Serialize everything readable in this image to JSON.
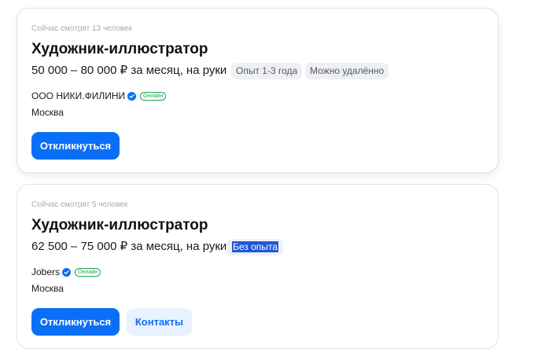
{
  "vacancies": [
    {
      "viewers": "Сейчас смотрят 13 человек",
      "title": "Художник-иллюстратор",
      "salary": "50 000 – 80 000 ₽ за месяц, на руки",
      "tags": [
        "Опыт 1-3 года",
        "Можно удалённо"
      ],
      "company": "ООО НИКИ.ФИЛИНИ",
      "online": "Онлайн",
      "city": "Москва",
      "respond_label": "Откликнуться"
    },
    {
      "viewers": "Сейчас смотрят 5 человек",
      "title": "Художник-иллюстратор",
      "salary": "62 500 – 75 000 ₽ за месяц, на руки",
      "tags": [
        "Без опыта"
      ],
      "company": "Jobers",
      "online": "Онлайн",
      "city": "Москва",
      "respond_label": "Откликнуться",
      "contacts_label": "Контакты"
    }
  ],
  "colors": {
    "accent": "#0a6ff7",
    "verified": "#0a6ff7",
    "online": "#1fa64a",
    "selection": "#1f58d6"
  }
}
